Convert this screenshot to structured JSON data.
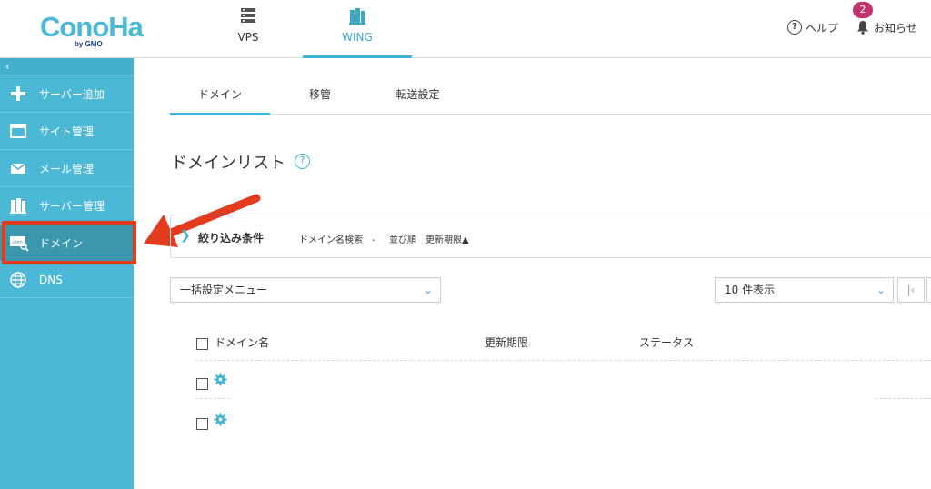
{
  "header": {
    "logo_text": "ConoHa",
    "logo_sub": "by GMO",
    "tabs": [
      {
        "label": "VPS",
        "icon": "server-icon",
        "active": false
      },
      {
        "label": "WING",
        "icon": "wing-icon",
        "active": true
      }
    ],
    "help_label": "ヘルプ",
    "notice_label": "お知らせ",
    "notice_count": "2"
  },
  "sidebar": {
    "collapse_glyph": "‹",
    "items": [
      {
        "label": "サーバー追加",
        "icon": "plus-icon"
      },
      {
        "label": "サイト管理",
        "icon": "window-icon"
      },
      {
        "label": "メール管理",
        "icon": "mail-icon"
      },
      {
        "label": "サーバー管理",
        "icon": "server-manage-icon"
      },
      {
        "label": "ドメイン",
        "icon": "domain-icon",
        "icon_text": ".com",
        "active": true
      },
      {
        "label": "DNS",
        "icon": "globe-icon"
      }
    ]
  },
  "main": {
    "subtabs": [
      {
        "label": "ドメイン",
        "active": true
      },
      {
        "label": "移管",
        "active": false
      },
      {
        "label": "転送設定",
        "active": false
      }
    ],
    "page_title": "ドメインリスト",
    "help_glyph": "?",
    "filter": {
      "chevron": "❯",
      "title": "絞り込み条件",
      "search_label": "ドメイン名検索　-",
      "sort_label": "並び順　更新期限▲"
    },
    "bulk_menu": {
      "value": "一括設定メニュー"
    },
    "count_select": {
      "value": "10 件表示"
    },
    "pagination": {
      "first_glyph": "|‹"
    },
    "table": {
      "headers": [
        "ドメイン名",
        "更新期限",
        "ステータス"
      ],
      "row_count": 2
    }
  },
  "colors": {
    "sidebar_bg": "#4bb8d6",
    "sidebar_active": "#3b97ad",
    "accent": "#3cb4d4",
    "annotation_red": "#e23b1d",
    "badge": "#c0336b"
  }
}
